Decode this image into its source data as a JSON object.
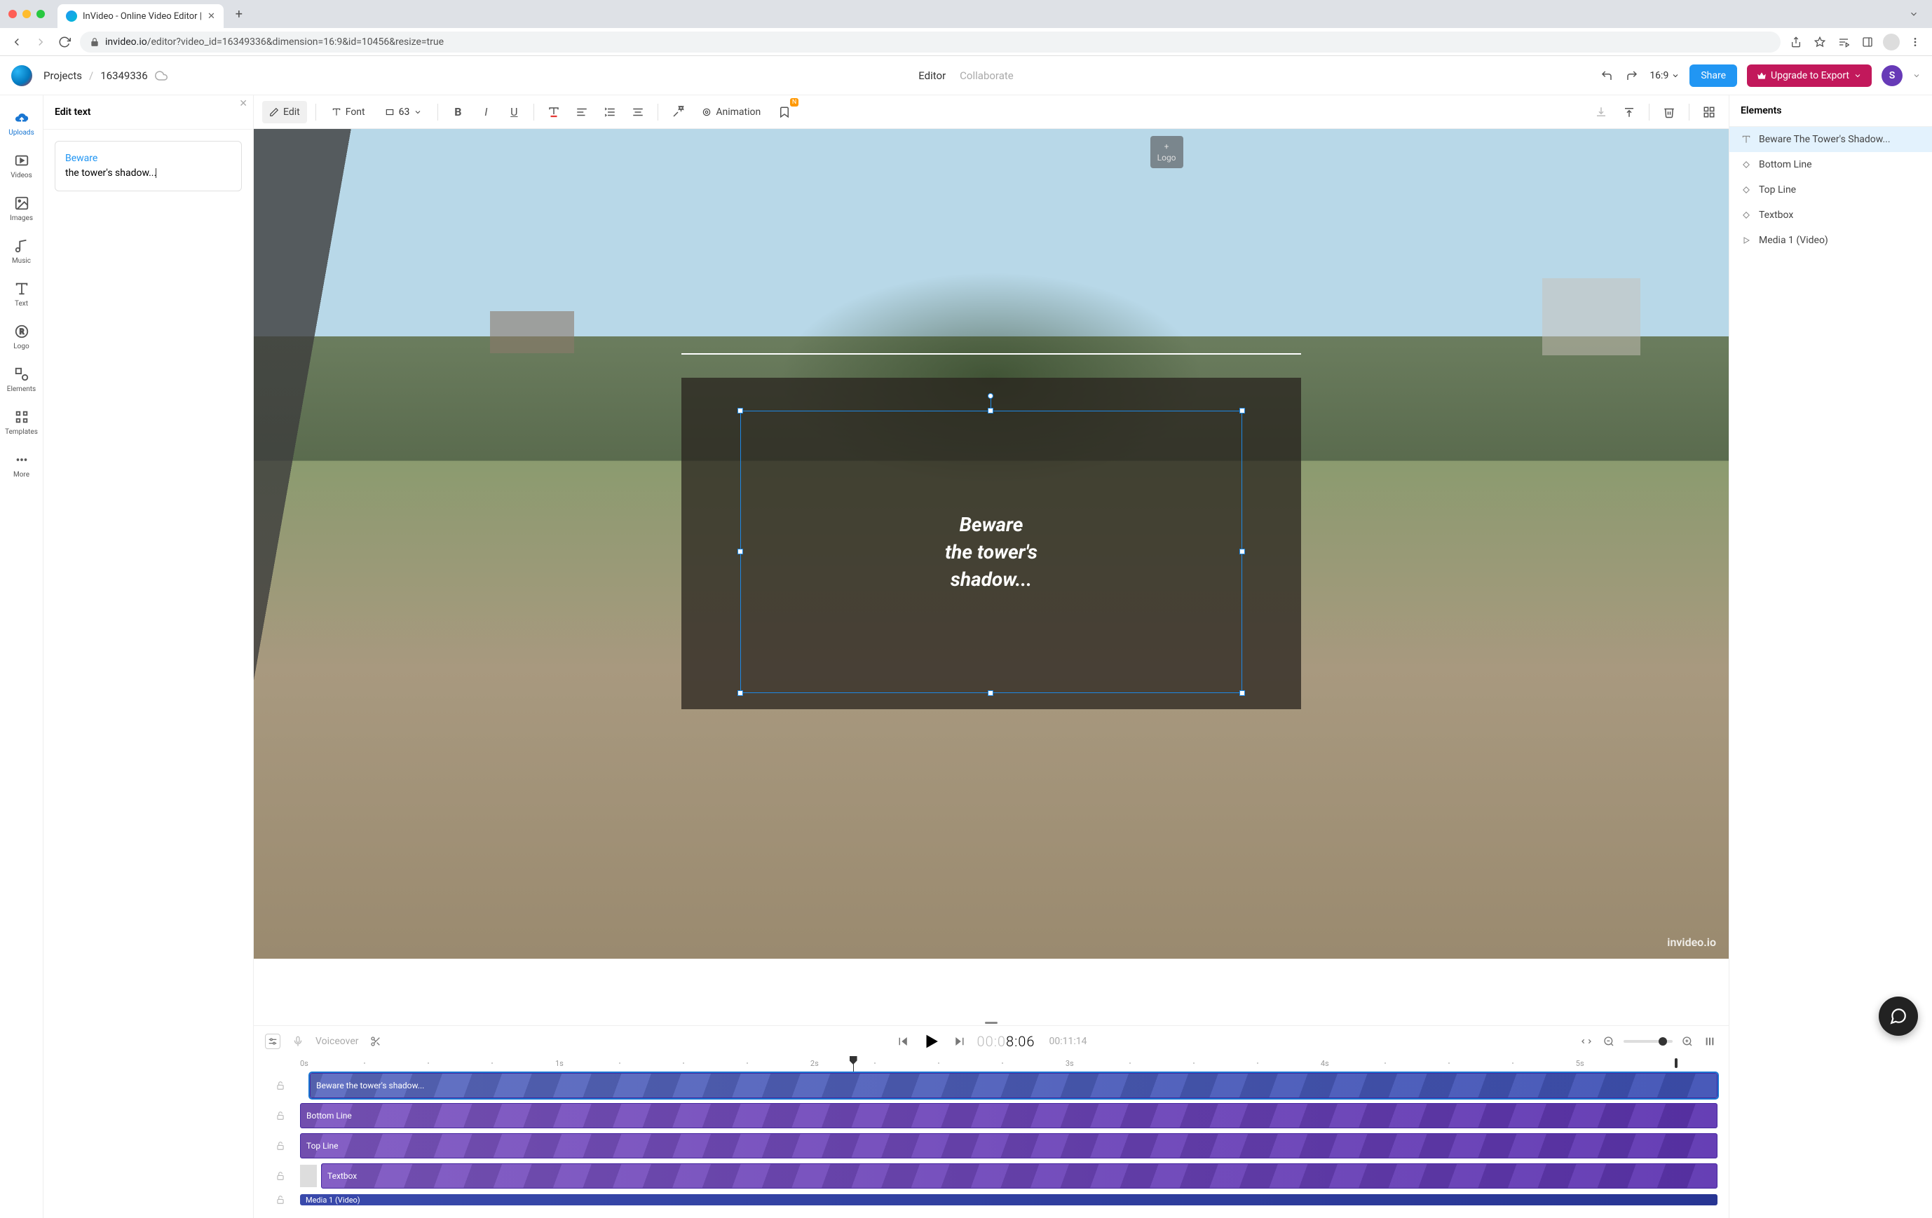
{
  "browser": {
    "tab_title": "InVideo - Online Video Editor |",
    "url_domain": "invideo.io",
    "url_path": "/editor?video_id=16349336&dimension=16:9&id=10456&resize=true"
  },
  "header": {
    "projects_label": "Projects",
    "video_id": "16349336",
    "tabs": {
      "editor": "Editor",
      "collaborate": "Collaborate"
    },
    "aspect": "16:9",
    "share": "Share",
    "export": "Upgrade to Export",
    "user_initial": "S"
  },
  "left_rail": {
    "uploads": "Uploads",
    "videos": "Videos",
    "images": "Images",
    "music": "Music",
    "text": "Text",
    "logo": "Logo",
    "elements": "Elements",
    "templates": "Templates",
    "more": "More"
  },
  "left_panel": {
    "title": "Edit text",
    "text_word1": "Beware",
    "text_rest": "the tower's shadow..."
  },
  "format_bar": {
    "edit": "Edit",
    "font": "Font",
    "size": "63",
    "animation": "Animation"
  },
  "canvas": {
    "logo_label": "Logo",
    "overlay_line1": "Beware",
    "overlay_line2": "the tower's",
    "overlay_line3": "shadow...",
    "watermark": "invideo.io"
  },
  "playback": {
    "voiceover": "Voiceover",
    "time_prefix": "00:0",
    "time_rest": "8:06",
    "total": "00:11:14"
  },
  "timeline": {
    "ticks": [
      "0s",
      "1s",
      "2s",
      "3s",
      "4s",
      "5s"
    ],
    "clip1": "Beware the tower's shadow...",
    "clip2": "Bottom Line",
    "clip3": "Top Line",
    "clip4": "Textbox",
    "clip5": "Media 1 (Video)"
  },
  "right_panel": {
    "title": "Elements",
    "items": [
      "Beware The Tower's Shadow...",
      "Bottom Line",
      "Top Line",
      "Textbox",
      "Media 1 (Video)"
    ]
  }
}
